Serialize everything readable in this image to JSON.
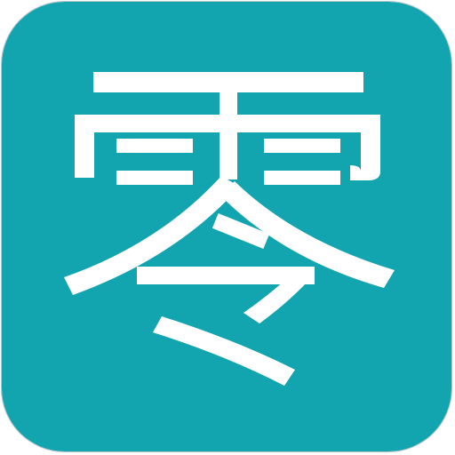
{
  "app_icon": {
    "character": "零",
    "background_color": "#12a5b0",
    "glyph_color": "#ffffff",
    "border_color": "#bfc6c8"
  }
}
